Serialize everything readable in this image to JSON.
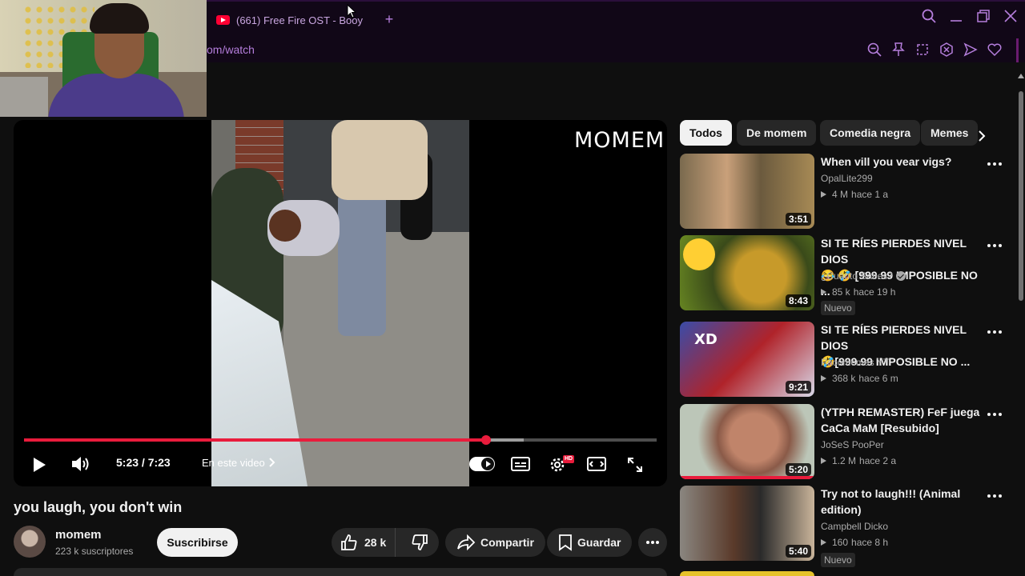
{
  "browser": {
    "tab_title": "(661) Free Fire OST - Booy",
    "url": "om/watch",
    "accent_color": "#b57edc"
  },
  "player": {
    "watermark": "MOMEM",
    "current_time": "5:23",
    "duration": "7:23",
    "time_display": "5:23 / 7:23",
    "progress_fraction": 0.73,
    "buffered_fraction": 0.79,
    "chapter_label": "En este video",
    "hd_badge": "HD"
  },
  "video": {
    "title": "you laugh, you don't win",
    "channel": "momem",
    "subscribers": "223 k suscriptores",
    "subscribe_label": "Suscribirse",
    "likes": "28 k",
    "share_label": "Compartir",
    "save_label": "Guardar"
  },
  "chips": [
    "Todos",
    "De momem",
    "Comedia negra",
    "Memes"
  ],
  "recommendations": [
    {
      "title_line1": "When vill you vear vigs?",
      "title_line2": "",
      "channel": "OpalLite299",
      "verified": false,
      "views": "4 M",
      "age": "hace 1 a",
      "duration": "3:51",
      "badge": "",
      "watched": false
    },
    {
      "title_line1": "SI TE RÍES PIERDES NIVEL DIOS",
      "title_line2": "😂 🤣 [999.99 IMPOSIBLE NO ...",
      "channel": "¿Cuánto Sabes?",
      "verified": true,
      "views": "85 k",
      "age": "hace 19 h",
      "duration": "8:43",
      "badge": "Nuevo",
      "watched": false
    },
    {
      "title_line1": "SI TE RÍES PIERDES NIVEL DIOS",
      "title_line2": "🤣[999.99 IMPOSIBLE NO ...",
      "channel": "Pacomemes YT",
      "verified": false,
      "views": "368 k",
      "age": "hace 6 m",
      "duration": "9:21",
      "badge": "",
      "watched": false
    },
    {
      "title_line1": "(YTPH REMASTER) FeF juega",
      "title_line2": "CaCa MaM [Resubido]",
      "channel": "JoSeS PooPer",
      "verified": false,
      "views": "1.2 M",
      "age": "hace 2 a",
      "duration": "5:20",
      "badge": "",
      "watched": true
    },
    {
      "title_line1": "Try not to laugh!!! (Animal",
      "title_line2": "edition)",
      "channel": "Campbell Dicko",
      "verified": false,
      "views": "160",
      "age": "hace 8 h",
      "duration": "5:40",
      "badge": "Nuevo",
      "watched": false
    }
  ]
}
